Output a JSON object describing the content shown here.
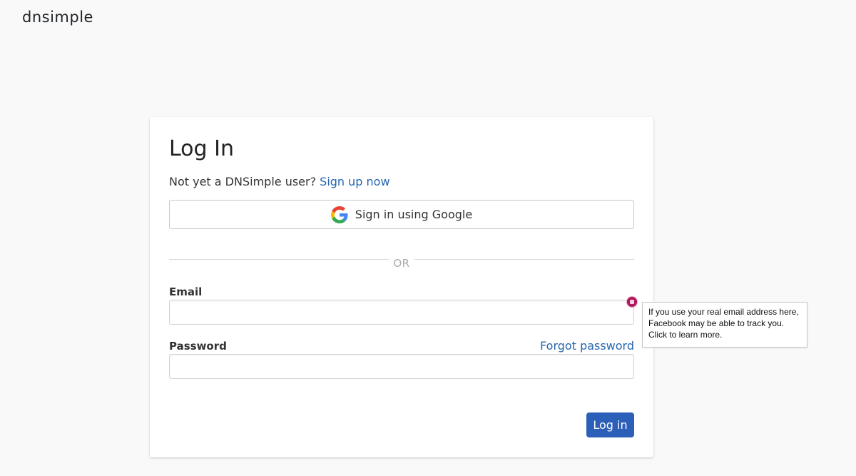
{
  "header": {
    "logo_text": "dnsimple"
  },
  "login": {
    "title": "Log In",
    "signup_prompt": "Not yet a DNSimple user?",
    "signup_link": "Sign up now",
    "google_button_label": "Sign in using Google",
    "divider_text": "OR",
    "email_label": "Email",
    "email_value": "",
    "password_label": "Password",
    "password_value": "",
    "forgot_password_link": "Forgot password",
    "submit_label": "Log in"
  },
  "extension": {
    "icon": "relay-badge-icon",
    "tooltip_lines": [
      "If you use your real email address here,",
      "Facebook may be able to track you.",
      "Click to learn more."
    ]
  },
  "colors": {
    "accent": "#2b5fb8",
    "link": "#2666b0",
    "page_background": "#f9f9f9",
    "badge": "#b0185c"
  }
}
